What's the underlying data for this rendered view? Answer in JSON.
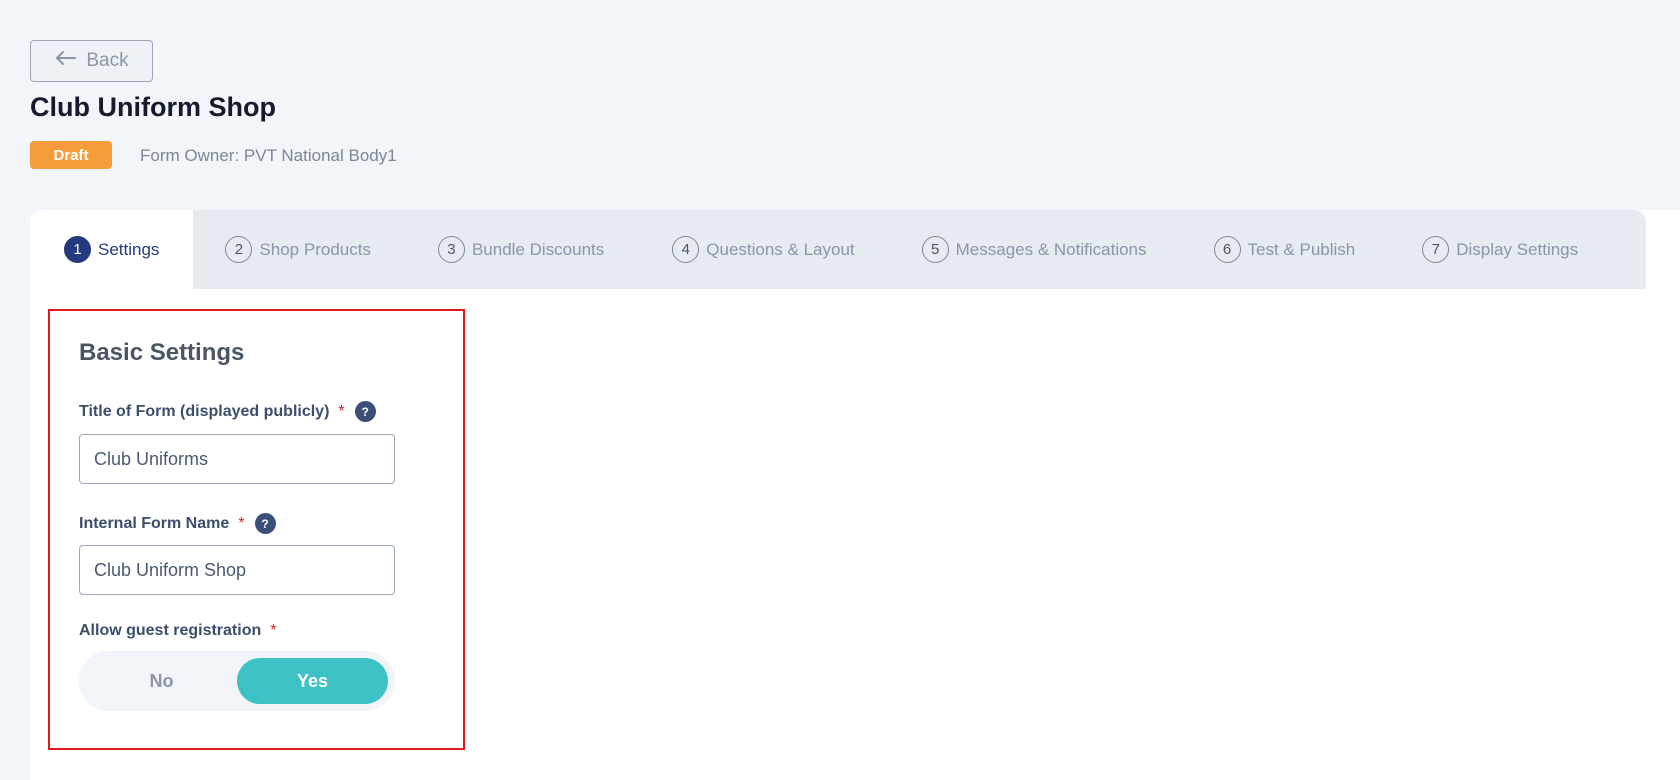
{
  "header": {
    "back_label": "Back",
    "title": "Club Uniform Shop",
    "status": "Draft",
    "owner": "Form Owner: PVT National Body1"
  },
  "tabs": [
    {
      "num": "1",
      "label": "Settings",
      "active": true
    },
    {
      "num": "2",
      "label": "Shop Products"
    },
    {
      "num": "3",
      "label": "Bundle Discounts"
    },
    {
      "num": "4",
      "label": "Questions & Layout"
    },
    {
      "num": "5",
      "label": "Messages & Notifications"
    },
    {
      "num": "6",
      "label": "Test & Publish"
    },
    {
      "num": "7",
      "label": "Display Settings"
    }
  ],
  "basic_settings": {
    "title": "Basic Settings",
    "form_title_label": "Title of Form (displayed publicly)",
    "form_title_value": "Club Uniforms",
    "internal_name_label": "Internal Form Name",
    "internal_name_value": "Club Uniform Shop",
    "guest_label": "Allow guest registration",
    "guest_options": [
      "No",
      "Yes"
    ],
    "guest_selected": "Yes",
    "required_mark": "*",
    "help_glyph": "?"
  },
  "colors": {
    "accent": "#24397e",
    "badge": "#f59d3a",
    "toggle_selected": "#3ec1c4",
    "required": "#e0191e",
    "highlight_border": "#e0191e"
  }
}
